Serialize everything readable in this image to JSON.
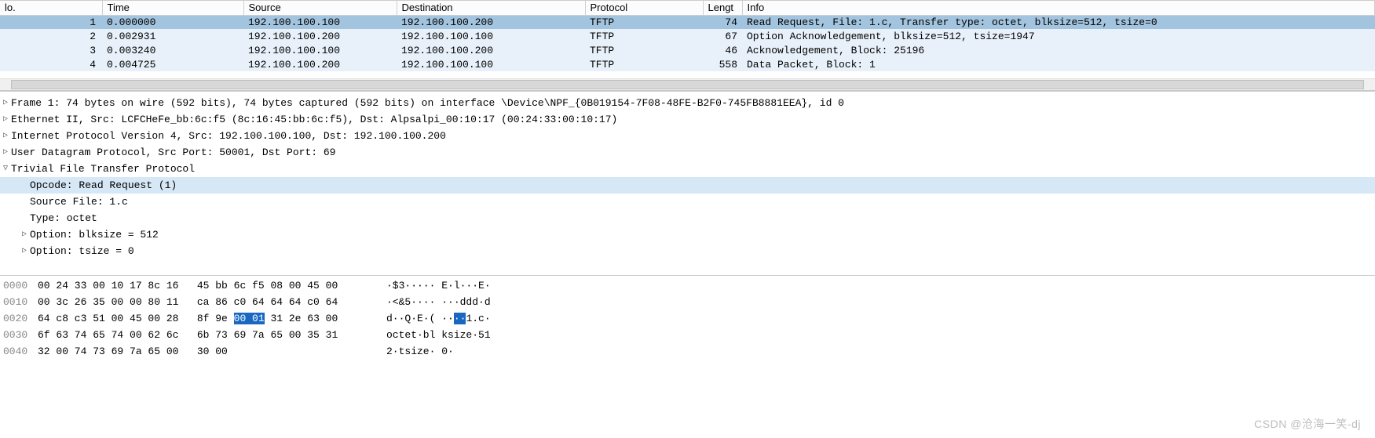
{
  "columns": {
    "no": "lo.",
    "time": "Time",
    "source": "Source",
    "destination": "Destination",
    "protocol": "Protocol",
    "length": "Lengt",
    "info": "Info"
  },
  "packets": [
    {
      "no": "1",
      "time": "0.000000",
      "src": "192.100.100.100",
      "dst": "192.100.100.200",
      "proto": "TFTP",
      "len": "74",
      "info": "Read Request, File: 1.c, Transfer type: octet, blksize=512, tsize=0",
      "sel": true
    },
    {
      "no": "2",
      "time": "0.002931",
      "src": "192.100.100.200",
      "dst": "192.100.100.100",
      "proto": "TFTP",
      "len": "67",
      "info": "Option Acknowledgement, blksize=512, tsize=1947",
      "sel": false
    },
    {
      "no": "3",
      "time": "0.003240",
      "src": "192.100.100.100",
      "dst": "192.100.100.200",
      "proto": "TFTP",
      "len": "46",
      "info": "Acknowledgement, Block: 25196",
      "sel": false
    },
    {
      "no": "4",
      "time": "0.004725",
      "src": "192.100.100.200",
      "dst": "192.100.100.100",
      "proto": "TFTP",
      "len": "558",
      "info": "Data Packet, Block: 1",
      "sel": false,
      "partial": true
    }
  ],
  "details": {
    "frame": "Frame 1: 74 bytes on wire (592 bits), 74 bytes captured (592 bits) on interface \\Device\\NPF_{0B019154-7F08-48FE-B2F0-745FB8881EEA}, id 0",
    "eth": "Ethernet II, Src: LCFCHeFe_bb:6c:f5 (8c:16:45:bb:6c:f5), Dst: Alpsalpi_00:10:17 (00:24:33:00:10:17)",
    "ip": "Internet Protocol Version 4, Src: 192.100.100.100, Dst: 192.100.100.200",
    "udp": "User Datagram Protocol, Src Port: 50001, Dst Port: 69",
    "tftp": "Trivial File Transfer Protocol",
    "opcode": "Opcode: Read Request (1)",
    "srcfile": "Source File: 1.c",
    "type": "Type: octet",
    "opt1": "Option: blksize = 512",
    "opt2": "Option: tsize = 0"
  },
  "hex": [
    {
      "off": "0000",
      "p1": "00 24 33 00 10 17 8c 16",
      "p2": "45 bb 6c f5 08 00 45 00",
      "asc1": "·$3····· E·l···E·"
    },
    {
      "off": "0010",
      "p1": "00 3c 26 35 00 00 80 11",
      "p2": "ca 86 c0 64 64 64 c0 64",
      "asc1": "·<&5···· ···ddd·d"
    },
    {
      "off": "0020",
      "p1": "64 c8 c3 51 00 45 00 28",
      "p2a": "8f 9e ",
      "p2hl": "00 01",
      "p2b": " 31 2e 63 00",
      "asc2a": "d··Q·E·( ··",
      "asc2hl": "··",
      "asc2b": "1.c·"
    },
    {
      "off": "0030",
      "p1": "6f 63 74 65 74 00 62 6c",
      "p2": "6b 73 69 7a 65 00 35 31",
      "asc1": "octet·bl ksize·51"
    },
    {
      "off": "0040",
      "p1": "32 00 74 73 69 7a 65 00",
      "p2": "30 00",
      "asc1": "2·tsize· 0·"
    }
  ],
  "watermark": "CSDN @沧海一笑-dj"
}
